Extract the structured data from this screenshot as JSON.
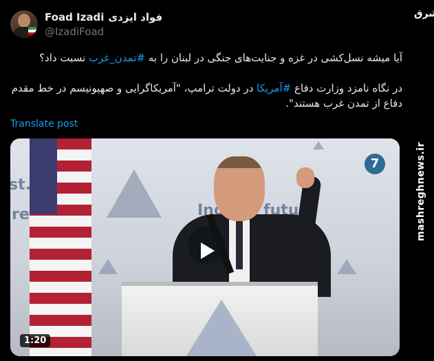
{
  "post": {
    "author_name_en": "Foad Izadi",
    "author_name_fa": "فواد ایزدی",
    "handle": "@IzadiFoad",
    "paragraph1_a": "آیا میشه نسل‌کشی در غزه و جنایت‌های جنگی در لبنان را به ",
    "paragraph1_hashtag": "#تمدن_غرب",
    "paragraph1_b": " نسبت داد؟",
    "paragraph2_a": "در نگاه نامزد وزارت دفاع ",
    "paragraph2_hashtag": "#آمریکا",
    "paragraph2_b": " در دولت ترامپ، \"آمریکاگرایی و صهیونیسم در خط مقدم دفاع از تمدن غرب هستند\".",
    "translate_label": "Translate post"
  },
  "media": {
    "duration": "1:20",
    "banner_text_1": "st.",
    "banner_text_2": "re.",
    "banner_text_3": "Ing the futu",
    "logo_badge": "7"
  },
  "watermark": {
    "logo": "مشرق",
    "site": "mashreghnews.ir"
  },
  "colors": {
    "accent": "#1d9bf0",
    "background": "#000000",
    "text": "#e7e9ea",
    "muted": "#71767b"
  }
}
